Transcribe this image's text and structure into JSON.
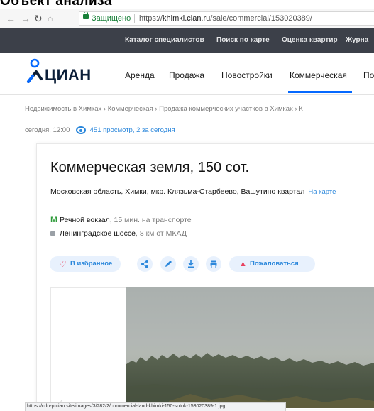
{
  "caption": "Объект анализа",
  "browser": {
    "secure_label": "Защищено",
    "url_prefix": "https://",
    "url_host": "khimki.cian.ru",
    "url_path": "/sale/commercial/153020389/"
  },
  "topbar": {
    "links": [
      "Каталог специалистов",
      "Поиск по карте",
      "Оценка квартир",
      "Журна"
    ]
  },
  "header": {
    "logo_text": "ЦИАН",
    "nav": [
      "Аренда",
      "Продажа",
      "Новостройки",
      "Коммерческая",
      "По"
    ],
    "active_nav": "Коммерческая",
    "accent_color": "#0468ff"
  },
  "breadcrumb": "Недвижимость в Химках  ›  Коммерческая  ›  Продажа коммерческих участков в Химках  ›  К",
  "meta": {
    "date": "сегодня, 12:00",
    "views": "451 просмотр, 2 за сегодня"
  },
  "listing": {
    "title": "Коммерческая земля, 150 сот.",
    "address": "Московская область, Химки, мкр. Клязьма-Старбеево, Вашутино квартал",
    "map_link": "На карте",
    "metro_name": "Речной вокзал",
    "metro_time": ", 15 мин. на транспорте",
    "highway_name": "Ленинградское шоссе",
    "highway_distance": ", 8 км от МКАД"
  },
  "actions": {
    "favorite_label": "В избранное",
    "share_icon": "share-icon",
    "edit_icon": "pencil-icon",
    "download_icon": "download-icon",
    "print_icon": "print-icon",
    "complain_label": "Пожаловаться"
  },
  "status_url": "https://cdn-p.cian.site/images/3/282/2/commercial-land-khimki-150-sotok-153020389-1.jpg"
}
